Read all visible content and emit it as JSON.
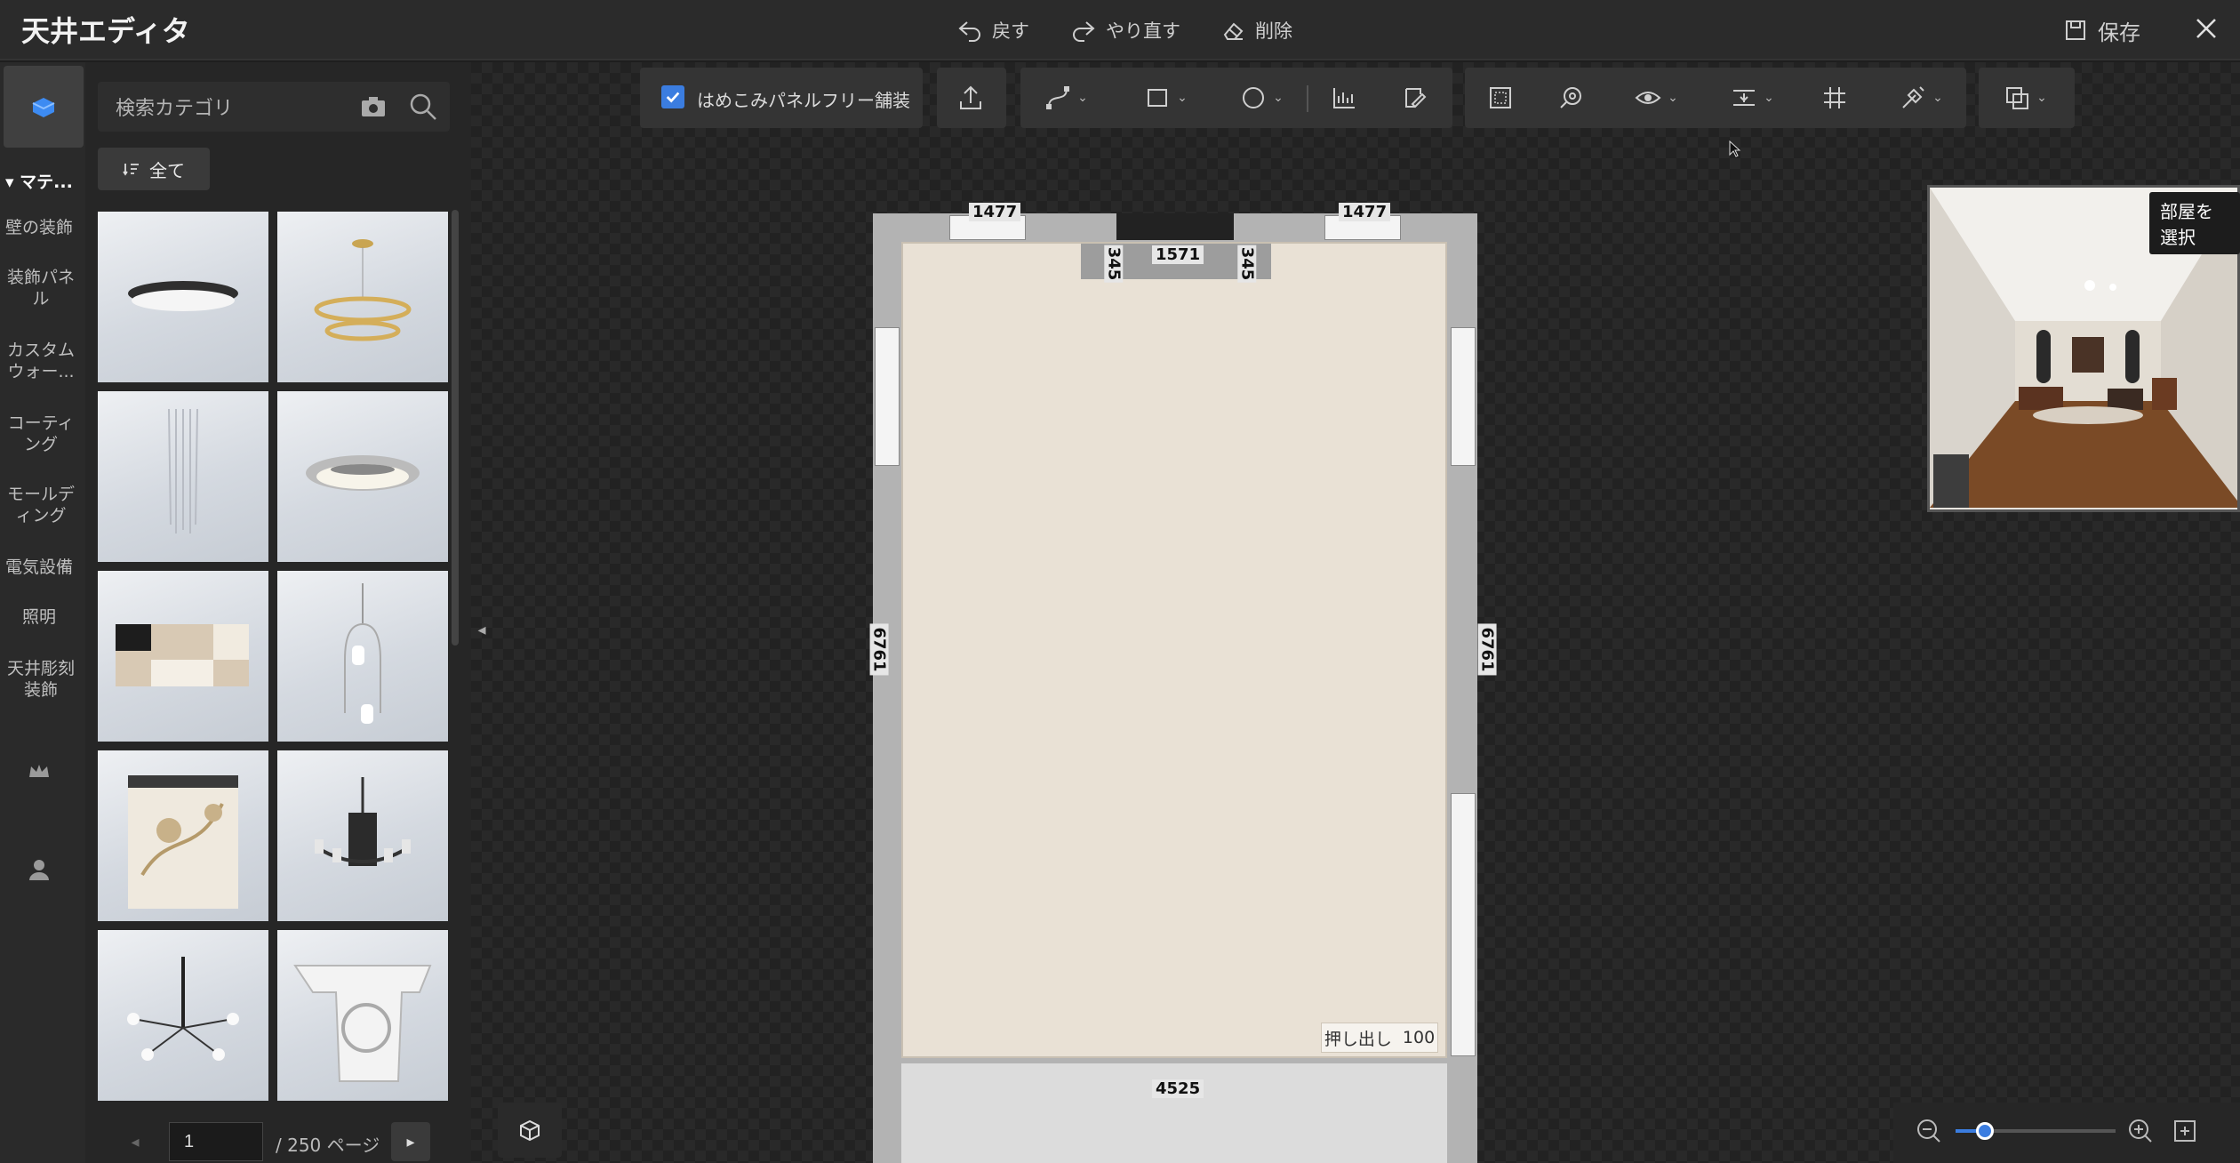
{
  "app": {
    "title": "天井エディタ"
  },
  "header": {
    "undo_label": "戻す",
    "redo_label": "やり直す",
    "delete_label": "削除",
    "save_label": "保存"
  },
  "sidebar": {
    "section_title": "マテ...",
    "items": [
      {
        "label": "壁の装飾"
      },
      {
        "label": "装飾パネル"
      },
      {
        "label": "カスタムウォー..."
      },
      {
        "label": "コーティング"
      },
      {
        "label": "モールディング"
      },
      {
        "label": "電気設備"
      },
      {
        "label": "照明"
      },
      {
        "label": "天井彫刻装飾"
      }
    ]
  },
  "panel": {
    "search_placeholder": "検索カテゴリ",
    "filter_label": "全て",
    "products": [
      {
        "icon": "flush-ceiling-light"
      },
      {
        "icon": "ring-chandelier"
      },
      {
        "icon": "crystal-pendant"
      },
      {
        "icon": "recessed-ceiling-light"
      },
      {
        "icon": "square-ceiling-light"
      },
      {
        "icon": "pendant-lamp"
      },
      {
        "icon": "floral-lantern"
      },
      {
        "icon": "classic-chandelier"
      },
      {
        "icon": "sputnik-chandelier"
      },
      {
        "icon": "ceiling-carving"
      }
    ],
    "pagination": {
      "current": "1",
      "total_label": "/ 250 ページ"
    }
  },
  "toolbar": {
    "checkbox_label": "はめこみパネルフリー舗装",
    "checkbox_checked": true
  },
  "plan": {
    "dim_top_left": "1477",
    "dim_top_right": "1477",
    "dim_niche": "1571",
    "dim_niche_left": "345",
    "dim_niche_right": "345",
    "dim_left": "6761",
    "dim_right": "6761",
    "dim_bottom": "4525",
    "extrude_label": "押し出し",
    "extrude_value": "100",
    "floor_color": "#e9e1d5",
    "wall_color": "#9a9a9a"
  },
  "preview": {
    "room_select_label": "部屋を選択"
  },
  "zoom": {
    "level": 0.2
  }
}
